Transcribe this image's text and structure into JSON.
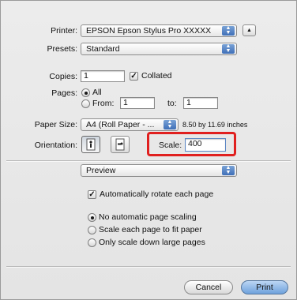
{
  "printer": {
    "label": "Printer:",
    "value": "EPSON Epson Stylus Pro XXXXX"
  },
  "presets": {
    "label": "Presets:",
    "value": "Standard"
  },
  "copies": {
    "label": "Copies:",
    "value": "1",
    "collated_label": "Collated",
    "collated_checked": true
  },
  "pages": {
    "label": "Pages:",
    "all_label": "All",
    "from_label": "From:",
    "from_value": "1",
    "to_label": "to:",
    "to_value": "1"
  },
  "paper_size": {
    "label": "Paper Size:",
    "value": "A4 (Roll Paper - ...",
    "dimensions": "8.50 by 11.69 inches"
  },
  "orientation": {
    "label": "Orientation:"
  },
  "scale": {
    "label": "Scale:",
    "value": "400"
  },
  "section_popup": {
    "value": "Preview"
  },
  "auto_rotate": {
    "label": "Automatically rotate each page",
    "checked": true
  },
  "scaling_options": [
    {
      "label": "No automatic page scaling",
      "selected": true
    },
    {
      "label": "Scale each page to fit paper",
      "selected": false
    },
    {
      "label": "Only scale down large pages",
      "selected": false
    }
  ],
  "buttons": {
    "cancel": "Cancel",
    "print": "Print"
  },
  "colors": {
    "highlight": "#e0201f",
    "accent": "#3f6fb8"
  }
}
